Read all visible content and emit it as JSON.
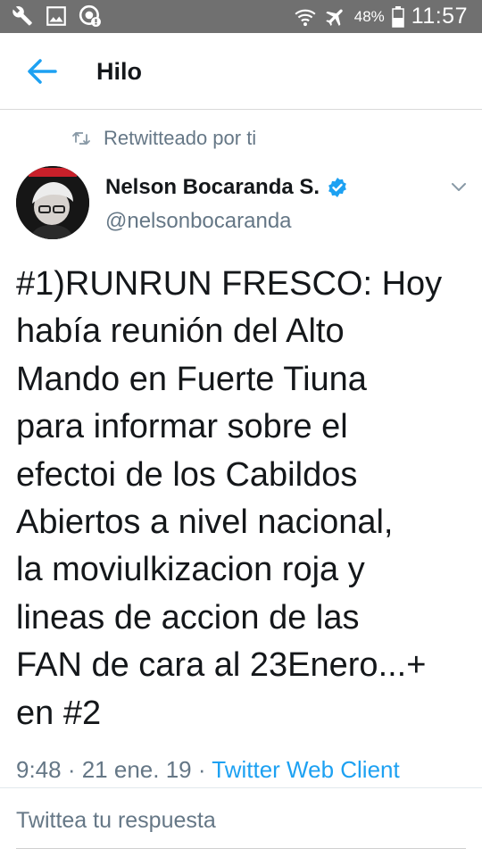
{
  "status_bar": {
    "left_icons": [
      "wrench-icon",
      "image-icon",
      "whatsapp-icon"
    ],
    "right_icons": [
      "wifi-icon",
      "airplane-icon",
      "battery-icon"
    ],
    "battery_percent": "48%",
    "time": "11:57"
  },
  "app_bar": {
    "back_icon": "arrow-left-icon",
    "title": "Hilo"
  },
  "tweet": {
    "retweet_context": "Retwitteado por ti",
    "author_name": "Nelson Bocaranda S.",
    "author_handle": "@nelsonbocaranda",
    "verified": true,
    "text": "#1)RUNRUN FRESCO: Hoy\nhabía reunión del Alto\nMando en Fuerte Tiuna\npara informar sobre el\nefectoi de los Cabildos\nAbiertos a nivel nacional,\nla moviulkizacion roja y\nlineas de accion de las\nFAN de cara al 23Enero...+\nen #2",
    "time": "9:48",
    "separator": " · ",
    "date": "21 ene. 19",
    "client": "Twitter Web Client"
  },
  "reply_composer": {
    "placeholder": "Twittea tu respuesta"
  },
  "colors": {
    "status_bar_bg": "#707070",
    "accent": "#1da1f2",
    "secondary_text": "#657786",
    "primary_text": "#14171a"
  }
}
